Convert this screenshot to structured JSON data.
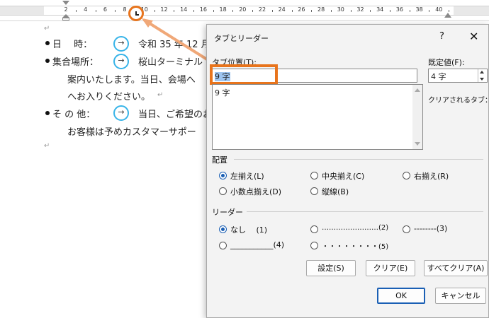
{
  "ruler": {
    "ticks": [
      "2",
      "4",
      "6",
      "8",
      "10",
      "12",
      "14",
      "16",
      "18",
      "20",
      "22",
      "24",
      "26",
      "28",
      "30",
      "32",
      "34",
      "36",
      "38",
      "40"
    ]
  },
  "document": {
    "line1": {
      "label": "日　 時：",
      "arrow": "→",
      "text": "令和 35 年 12 月"
    },
    "line2": {
      "label": "集合場所：",
      "arrow": "→",
      "text": "桜山ターミナル"
    },
    "line3": "案内いたします。当日、会場へ",
    "line4": "へお入りください。",
    "line5": {
      "label": "そ の 他：",
      "arrow": "→",
      "text": "当日、ご希望のお"
    },
    "line6": "お客様は予めカスタマーサポー",
    "para_mark": "↵"
  },
  "dialog": {
    "title": "タブとリーダー",
    "help": "?",
    "close": "✕",
    "tab_position_label": "タブ位置(T):",
    "tab_position_value": "9 字",
    "tab_list": [
      "9 字"
    ],
    "default_label": "既定値(F):",
    "default_value": "4 字",
    "clear_tabs_label": "クリアされるタブ：",
    "alignment_label": "配置",
    "alignment": {
      "left": "左揃え(L)",
      "center": "中央揃え(C)",
      "right": "右揃え(R)",
      "decimal": "小数点揃え(D)",
      "bar": "縦線(B)"
    },
    "leader_label": "リーダー",
    "leader": {
      "none": "なし　 (1)",
      "dots": "……………………(2)",
      "dashes": "--------(3)",
      "underline": "___________(4)",
      "middots": "・・・・・・・・(5)"
    },
    "buttons": {
      "set": "設定(S)",
      "clear": "クリア(E)",
      "clear_all": "すべてクリア(A)",
      "ok": "OK",
      "cancel": "キャンセル"
    }
  },
  "colors": {
    "highlight_orange": "#e8741c",
    "arrow_circle_blue": "#38b4e8",
    "radio_blue": "#1a5fb4"
  }
}
